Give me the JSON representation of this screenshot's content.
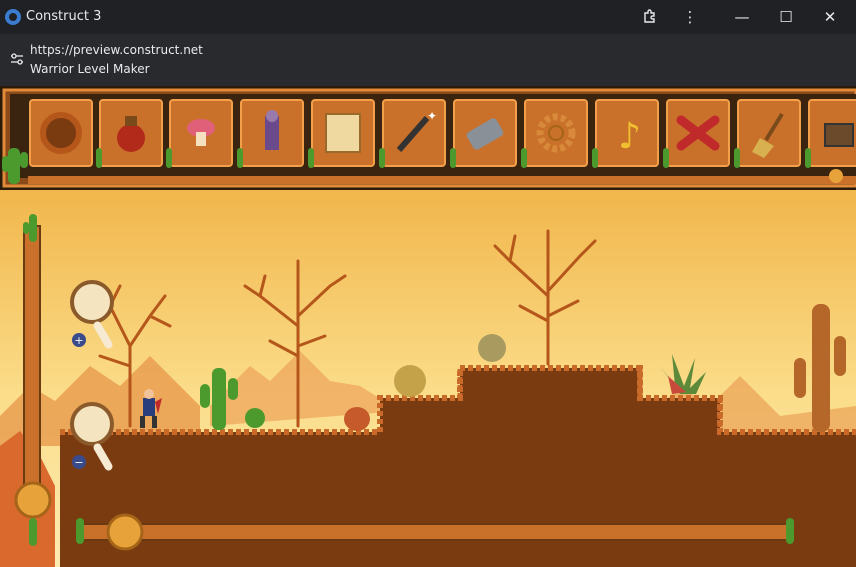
{
  "window": {
    "title": "Construct 3",
    "controls": {
      "minimize": "—",
      "maximize": "☐",
      "close": "✕",
      "menu": "⋮"
    }
  },
  "address": {
    "url": "https://preview.construct.net",
    "page_title": "Warrior Level Maker"
  },
  "toolbar": {
    "tools": [
      {
        "name": "ground-tool",
        "icon": "dirt-ring-icon"
      },
      {
        "name": "potion-tool",
        "icon": "potion-icon"
      },
      {
        "name": "mushroom-tool",
        "icon": "mushroom-icon"
      },
      {
        "name": "enemy-tool",
        "icon": "zombie-icon"
      },
      {
        "name": "map-tool",
        "icon": "map-scroll-icon"
      },
      {
        "name": "magic-tool",
        "icon": "magic-wand-icon"
      },
      {
        "name": "eraser-tool",
        "icon": "eraser-icon"
      },
      {
        "name": "settings-tool",
        "icon": "gear-icon"
      },
      {
        "name": "music-tool",
        "icon": "music-note-icon"
      },
      {
        "name": "delete-tool",
        "icon": "red-x-icon"
      },
      {
        "name": "clear-tool",
        "icon": "broom-icon"
      },
      {
        "name": "more-tool",
        "icon": "chest-icon"
      }
    ]
  },
  "zoom": {
    "zoom_in_icon": "plus-icon",
    "zoom_out_icon": "minus-icon"
  },
  "colors": {
    "sky_top": "#f2b94f",
    "sky_bottom": "#fbe39a",
    "dirt": "#7a3b10",
    "frame_orange": "#c9702a",
    "frame_dark": "#6a3a12",
    "cactus": "#4c9a2e"
  }
}
